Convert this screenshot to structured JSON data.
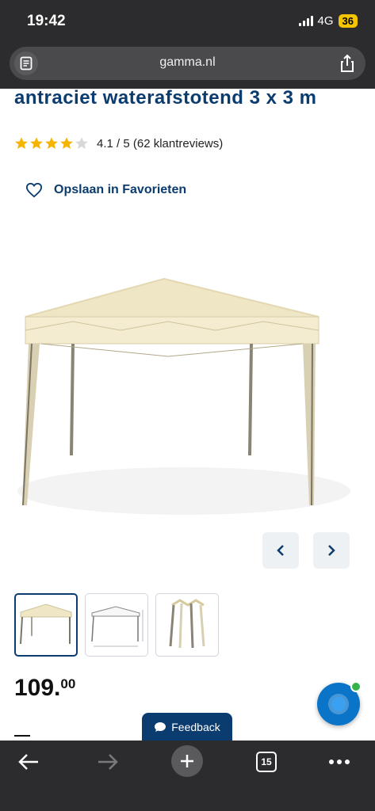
{
  "status": {
    "time": "19:42",
    "network": "4G",
    "battery": "36"
  },
  "browser": {
    "url": "gamma.nl",
    "tabs_count": "15"
  },
  "product": {
    "title_fragment": "antraciet waterafstotend 3 x 3 m",
    "rating_value": 4.1,
    "rating_text": "4.1 / 5 (62 klantreviews)",
    "stars_filled": 4,
    "stars_total": 5,
    "save_label": "Opslaan in Favorieten",
    "price_main": "109.",
    "price_cents": "00"
  },
  "gallery": {
    "active_index": 0,
    "thumbnail_count": 3
  },
  "feedback": {
    "label": "Feedback"
  },
  "colors": {
    "brand_blue": "#0b3c6f",
    "star_gold": "#f5b400",
    "star_empty": "#d8d8d8",
    "chat_blue": "#0a74c9",
    "chat_dot": "#35b34a",
    "chrome_dark": "#2c2c2e"
  },
  "icons": {
    "reader": "reader-icon",
    "share": "share-icon",
    "heart": "heart-icon",
    "prev": "chevron-left-icon",
    "next": "chevron-right-icon",
    "chat": "chat-icon",
    "back": "arrow-left-icon",
    "forward": "arrow-right-icon",
    "new_tab": "plus-icon",
    "more": "more-icon"
  }
}
